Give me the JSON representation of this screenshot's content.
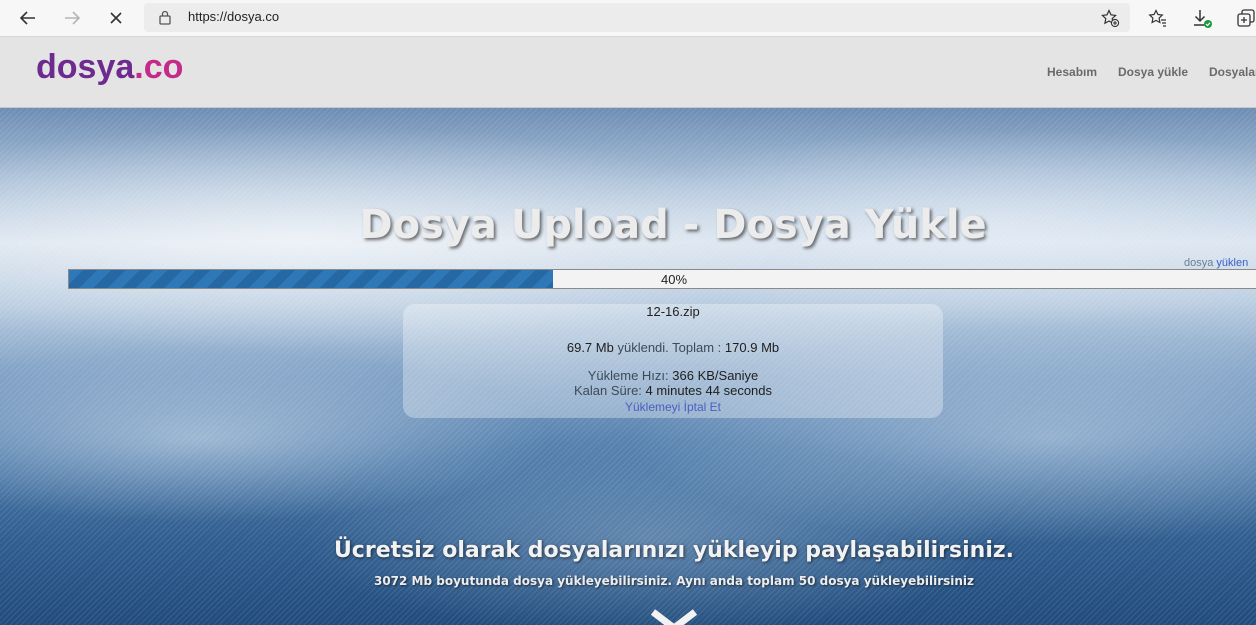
{
  "browser": {
    "url": "https://dosya.co",
    "back_icon": "arrow-left-icon",
    "forward_icon": "arrow-right-icon",
    "stop_icon": "close-icon",
    "lock_icon": "lock-icon",
    "add_favorite_icon": "star-plus-icon",
    "favorites_icon": "favorites-list-icon",
    "downloads_icon": "download-icon",
    "collections_icon": "collections-icon"
  },
  "site": {
    "logo_text": "dosya",
    "logo_dot_text": ".co",
    "logo_color": "#6d2b8f",
    "logo_accent": "#c42a8a",
    "nav": [
      "Hesabım",
      "Dosya yükle",
      "Dosyalar"
    ]
  },
  "hero": {
    "title": "Dosya Upload - Dosya Yükle",
    "right_hint_prefix": "dosya",
    "right_hint_link": "yüklen",
    "progress": {
      "percent": 40,
      "label": "40%",
      "fill_color": "#2e78b8"
    },
    "file_name": "12-16.zip",
    "uploaded_value": "69.7 Mb",
    "uploaded_label": "yüklendi. Toplam :",
    "total_value": "170.9 Mb",
    "speed_label": "Yükleme Hızı:",
    "speed_value": "366 KB/Saniye",
    "remaining_label": "Kalan Süre:",
    "remaining_value": "4 minutes 44 seconds",
    "cancel_link": "Yüklemeyi İptal Et",
    "tagline": "Ücretsiz olarak dosyalarınızı yükleyip paylaşabilirsiniz.",
    "subline": "3072 Mb boyutunda dosya yükleyebilirsiniz. Aynı anda toplam 50 dosya yükleyebilirsiniz",
    "scroll_icon": "chevron-down-icon"
  }
}
